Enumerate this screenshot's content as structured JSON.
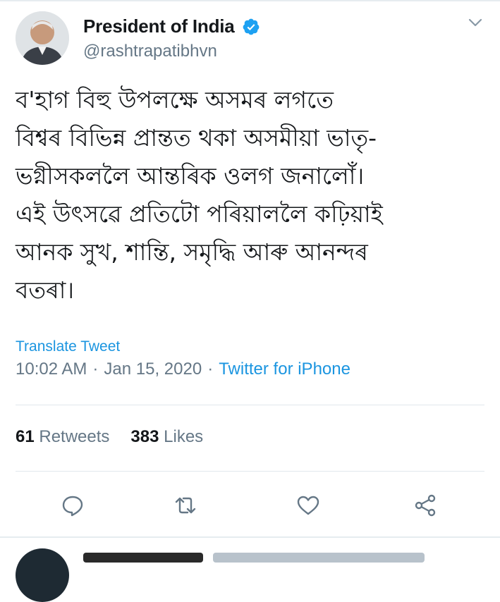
{
  "author": {
    "display_name": "President of India",
    "handle": "@rashtrapatibhvn",
    "verified": true
  },
  "tweet": {
    "lines": [
      "ব'হাগ বিহু উপলক্ষে অসমৰ লগতে",
      "বিশ্বৰ বিভিন্ন প্ৰান্তত থকা অসমীয়া ভাতৃ-",
      "ভগ্নীসকললৈ আন্তৰিক ওলগ জনালোঁ।",
      "এই উৎসৱে প্ৰতিটো পৰিয়াললৈ কঢ়িয়াই",
      "আনক সুখ, শান্তি, সমৃদ্ধি আৰু আনন্দৰ",
      "বতৰা।"
    ],
    "translate_label": "Translate Tweet",
    "time": "10:02 AM",
    "separator": "·",
    "date": "Jan 15, 2020",
    "source": "Twitter for iPhone"
  },
  "stats": {
    "retweets_count": "61",
    "retweets_label": "Retweets",
    "likes_count": "383",
    "likes_label": "Likes"
  },
  "icons": {
    "reply": "reply-icon",
    "retweet": "retweet-icon",
    "like": "heart-icon",
    "share": "share-icon",
    "more": "chevron-down-icon",
    "verified": "verified-badge-icon"
  },
  "colors": {
    "accent": "#1b95e0",
    "text": "#14171a",
    "muted": "#657786",
    "divider": "#e1e8ed"
  }
}
